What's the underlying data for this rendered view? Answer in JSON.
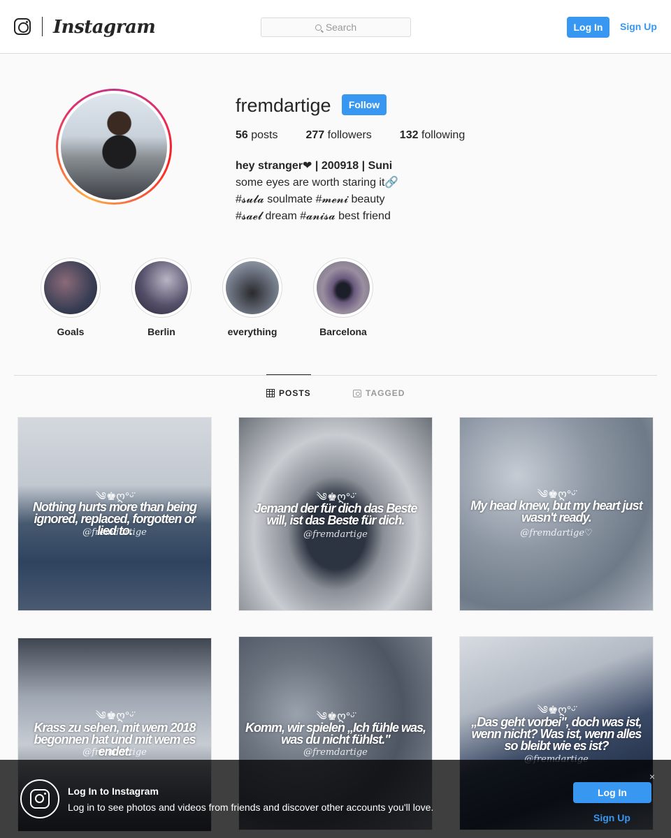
{
  "nav": {
    "wordmark": "Instagram",
    "search_placeholder": "Search",
    "login_label": "Log In",
    "signup_label": "Sign Up"
  },
  "profile": {
    "username": "fremdartige",
    "follow_label": "Follow",
    "stats": [
      {
        "count": "56",
        "label": "posts"
      },
      {
        "count": "277",
        "label": "followers"
      },
      {
        "count": "132",
        "label": "following"
      }
    ],
    "bio": {
      "name": "hey stranger❤ | 200918 | Suni",
      "lines": [
        "some eyes are worth staring it🔗",
        "#𝓼𝓾𝓵𝓪 soulmate #𝓶𝓮𝓷𝓲 beauty",
        "#𝓼𝓪𝓮𝓵 dream #𝓪𝓷𝓲𝓼𝓪 best friend"
      ]
    }
  },
  "highlights": [
    {
      "label": "Goals"
    },
    {
      "label": "Berlin"
    },
    {
      "label": "everything"
    },
    {
      "label": "Barcelona"
    }
  ],
  "tabs": {
    "posts": "POSTS",
    "tagged": "TAGGED"
  },
  "posts": [
    {
      "quote": "Nothing hurts more than being ignored, replaced, forgotten or lied to.",
      "deco": "༄♚ღ°ᵕ̈",
      "handle": "@fremdartige"
    },
    {
      "quote": "Jemand der für dich das Beste will, ist das Beste für dich.",
      "deco": "༄♚ღ°ᵕ̈",
      "handle": "@fremdartige"
    },
    {
      "quote": "My head knew, but my heart just wasn't ready.",
      "deco": "༄♚ღ°ᵕ̈",
      "handle": "@fremdartige♡"
    },
    {
      "quote": "Krass zu sehen, mit wem 2018 begonnen hat und mit wem es endet.",
      "deco": "༄♚ღ°ᵕ̈",
      "handle": "@fremdartige"
    },
    {
      "quote": "Komm, wir spielen „Ich fühle was, was du nicht fühlst.\"",
      "deco": "༄♚ღ°ᵕ̈",
      "handle": "@fremdartige"
    },
    {
      "quote": "„Das geht vorbei\", doch was ist, wenn nicht? Was ist, wenn alles so bleibt wie es ist?",
      "deco": "༄♚ღ°ᵕ̈",
      "handle": "@fremdartige"
    }
  ],
  "banner": {
    "title": "Log In to Instagram",
    "text": "Log in to see photos and videos from friends and discover other accounts you'll love.",
    "close": "×",
    "login_label": "Log In",
    "signup_label": "Sign Up"
  },
  "colors": {
    "accent": "#3897f0",
    "text": "#262626",
    "muted": "#999999",
    "border": "#dbdbdb"
  }
}
